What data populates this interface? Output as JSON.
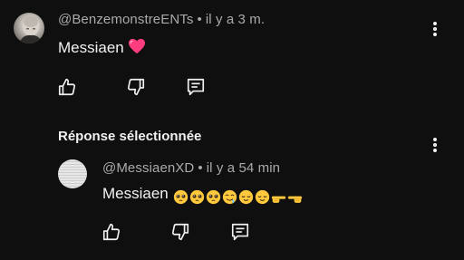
{
  "comment": {
    "author": "@BenzemonstreENTs",
    "separator": "•",
    "time": "il y a 3 m.",
    "text": "Messiaen",
    "emoji": "heart-icon",
    "actions": [
      "like-icon",
      "dislike-icon",
      "reply-icon"
    ],
    "menu": "more-vertical-icon"
  },
  "reply_section": {
    "title": "Réponse sélectionnée",
    "menu": "more-vertical-icon"
  },
  "reply": {
    "author": "@MessiaenXD",
    "separator": "•",
    "time": "il y a 54 min",
    "text": "Messiaen",
    "emojis": [
      "pleading-face",
      "pleading-face",
      "pleading-face",
      "drooling-face",
      "relieved-face",
      "relieved-face",
      "pointing-right",
      "pointing-left"
    ],
    "actions": [
      "like-icon",
      "dislike-icon",
      "reply-icon"
    ],
    "menu": "more-vertical-icon"
  },
  "colors": {
    "background": "#0f0f0f",
    "text": "#f1f1f1",
    "meta": "#aaaaaa",
    "heart": "#ff3d7f",
    "emoji_face": "#ffc83d"
  }
}
